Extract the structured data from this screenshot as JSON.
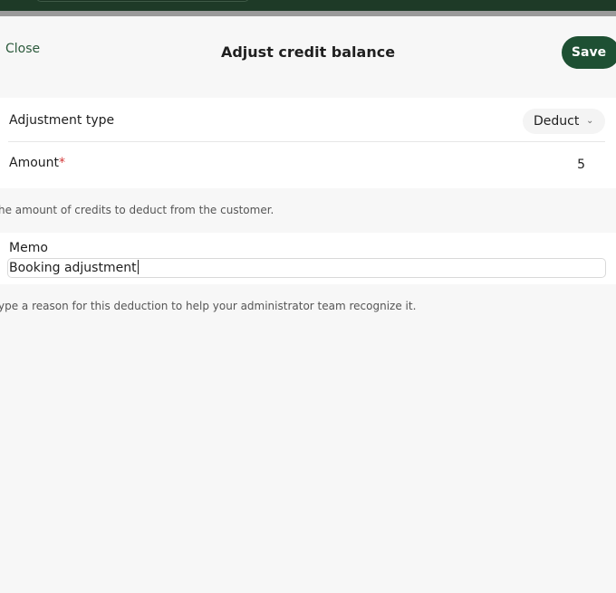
{
  "dialog": {
    "title": "Adjust credit balance",
    "close_label": "Close",
    "save_label": "Save"
  },
  "form": {
    "adjustment_type": {
      "label": "Adjustment type",
      "value": "Deduct"
    },
    "amount": {
      "label": "Amount",
      "required_marker": "*",
      "value": "5",
      "help": "he amount of credits to deduct from the customer."
    },
    "memo": {
      "label": "Memo",
      "value": "Booking adjustment",
      "help": "ype a reason for this deduction to help your administrator team recognize it."
    }
  },
  "colors": {
    "accent": "#1e5033",
    "required": "#d43b3b",
    "topbar": "#1e3a27"
  }
}
